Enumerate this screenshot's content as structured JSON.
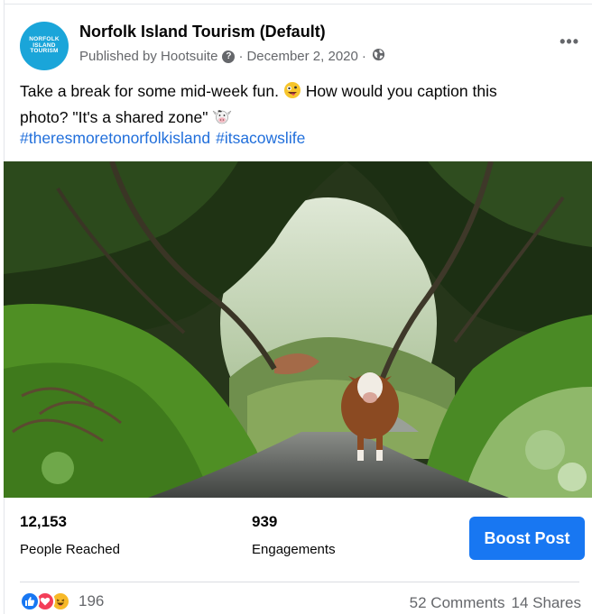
{
  "post": {
    "page_name": "Norfolk Island Tourism (Default)",
    "avatar_text": "NORFOLK ISLAND TOURISM",
    "published_by": "Published by Hootsuite",
    "date": "December 2, 2020",
    "dot": "·",
    "more_label": "•••",
    "caption_line1": "Take a break for some mid-week fun.",
    "caption_line1b": "How would you caption this",
    "caption_line2": "photo? \"It's a shared zone\"",
    "hashtags": [
      "#theresmoretonorfolkisland",
      "#itsacowslife"
    ],
    "image_alt": "Cow walking on a road through a green tree tunnel"
  },
  "stats": {
    "people_reached_value": "12,153",
    "people_reached_label": "People Reached",
    "engagements_value": "939",
    "engagements_label": "Engagements",
    "boost_label": "Boost Post"
  },
  "footer": {
    "reaction_count": "196",
    "comments": "52 Comments",
    "shares": "14 Shares"
  },
  "colors": {
    "accent": "#1877f2",
    "link": "#216fdb",
    "avatar": "#1aa5d9"
  }
}
